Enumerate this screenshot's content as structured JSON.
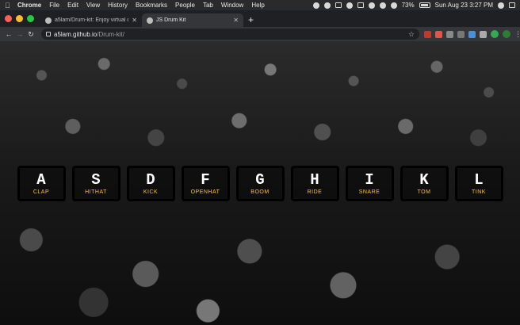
{
  "menubar": {
    "app": "Chrome",
    "items": [
      "File",
      "Edit",
      "View",
      "History",
      "Bookmarks",
      "People",
      "Tab",
      "Window",
      "Help"
    ],
    "battery": "73%",
    "clock": "Sun Aug 23  3:27 PM"
  },
  "tabs": [
    {
      "title": "a5lam/Drum-kit: Enjoy virtual d",
      "active": false,
      "icon": "github-icon"
    },
    {
      "title": "JS Drum Kit",
      "active": true,
      "icon": "globe-icon"
    }
  ],
  "address": {
    "host": "a5lam.github.io",
    "path": "/Drum-kit/"
  },
  "keys": [
    {
      "key": "A",
      "sound": "CLAP"
    },
    {
      "key": "S",
      "sound": "HITHAT"
    },
    {
      "key": "D",
      "sound": "KICK"
    },
    {
      "key": "F",
      "sound": "OPENHAT"
    },
    {
      "key": "G",
      "sound": "BOOM"
    },
    {
      "key": "H",
      "sound": "RIDE"
    },
    {
      "key": "I",
      "sound": "SNARE"
    },
    {
      "key": "K",
      "sound": "TOM"
    },
    {
      "key": "L",
      "sound": "TINK"
    }
  ],
  "colors": {
    "sound_label": "#ffc600",
    "key_letter": "#ffffff",
    "traffic_red": "#ff5f57",
    "traffic_yellow": "#febc2e",
    "traffic_green": "#28c840"
  }
}
